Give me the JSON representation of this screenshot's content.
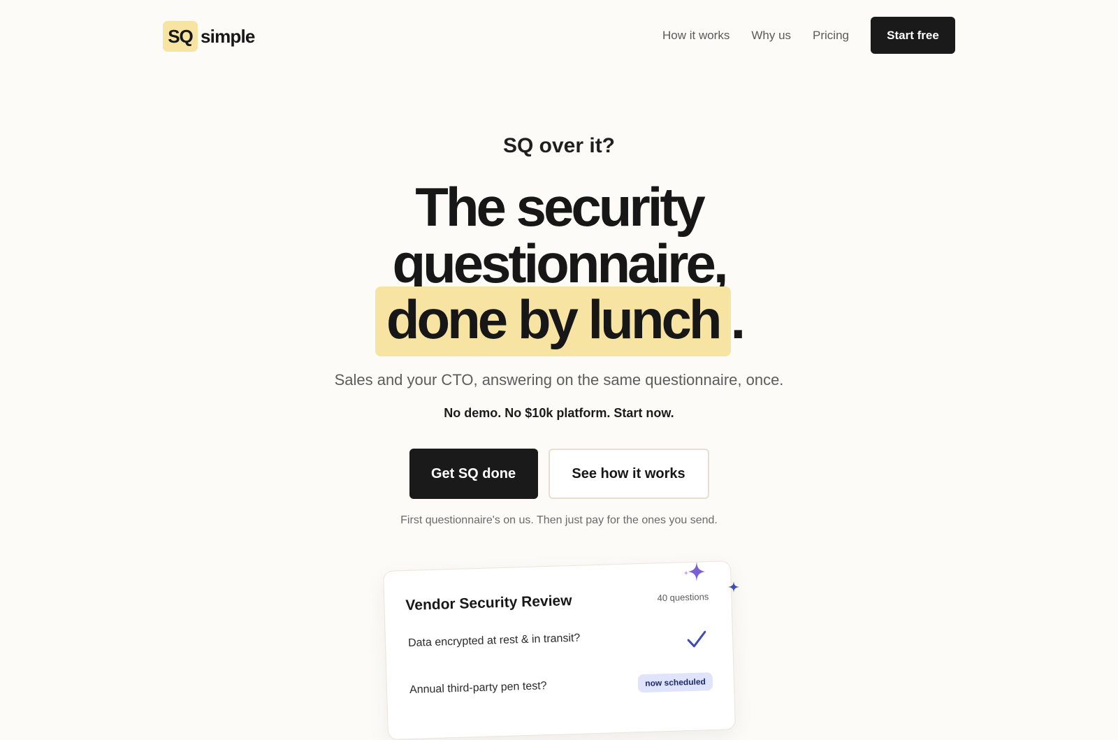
{
  "header": {
    "logo_mark": "SQ",
    "logo_word": "simple",
    "nav": [
      "How it works",
      "Why us",
      "Pricing"
    ],
    "cta": "Start free"
  },
  "hero": {
    "eyebrow": "SQ over it?",
    "headline_line1": "The security",
    "headline_line2": "questionnaire,",
    "headline_highlight": "done by lunch",
    "headline_period": ".",
    "subhead": "Sales and your CTO, answering on the same questionnaire, once.",
    "tagline": "No demo. No $10k platform. Start now.",
    "primary_cta": "Get SQ done",
    "secondary_cta": "See how it works",
    "fineprint": "First questionnaire's on us. Then just pay for the ones you send."
  },
  "card": {
    "title": "Vendor Security Review",
    "count": "40 questions",
    "question1": "Data encrypted at rest & in transit?",
    "question2": "Annual third-party pen test?",
    "badge": "now scheduled",
    "check_icon": "check-icon",
    "accent_color": "#3b4bb8",
    "sparkle_colors": [
      "#7b5fd6",
      "#3b4bb8"
    ]
  },
  "colors": {
    "background": "#fcfbf8",
    "highlight": "#f7e3a2",
    "primary": "#1a1a1a"
  }
}
